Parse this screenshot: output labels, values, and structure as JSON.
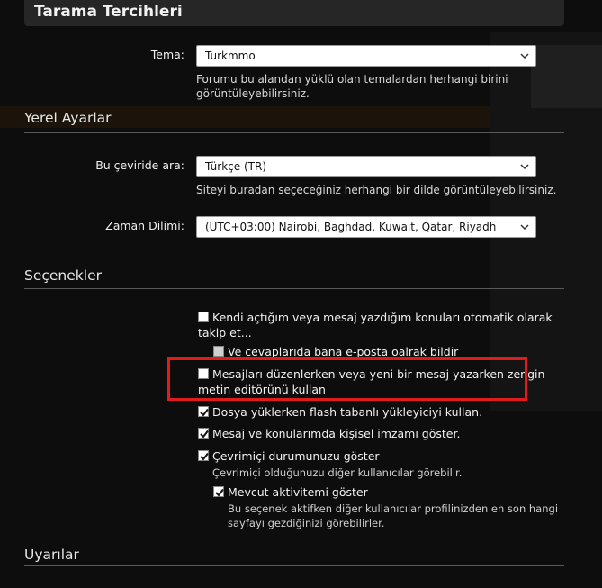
{
  "dialog": {
    "title": "Tarama Tercihleri"
  },
  "theme": {
    "label": "Tema:",
    "value": "Turkmmo",
    "hint_line1": "Forumu bu alandan yüklü olan temalardan herhangi birini",
    "hint_line2": "görüntüleyebilirsiniz."
  },
  "local": {
    "section_title": "Yerel Ayarlar",
    "language_label": "Bu çeviride ara:",
    "language_value": "Türkçe (TR)",
    "language_hint": "Siteyi buradan seçeceğiniz herhangi bir dilde görüntüleyebilirsiniz.",
    "timezone_label": "Zaman Dilimi:",
    "timezone_value": "(UTC+03:00) Nairobi, Baghdad, Kuwait, Qatar, Riyadh"
  },
  "options": {
    "section_title": "Seçenekler",
    "watch_line1": "Kendi açtığım veya mesaj yazdığım konuları otomatik olarak",
    "watch_line2": "takip et...",
    "email_label": "Ve cevaplarıda bana e-posta oalrak bildir",
    "editor_line1": "Mesajları düzenlerken veya yeni bir mesaj yazarken zengin",
    "editor_line2": "metin editörünü kullan",
    "flash_label": "Dosya yüklerken flash tabanlı yükleyiciyi kullan.",
    "signature_label": "Mesaj ve konularımda kişisel imzamı göster.",
    "online_label": "Çevrimiçi durumunuzu göster",
    "online_hint": "Çevrimiçi olduğunuzu diğer kullanıcılar görebilir.",
    "activity_label": "Mevcut aktivitemi göster",
    "activity_hint1": "Bu seçenek aktifken diğer kullanıcılar profilinizden en son hangi",
    "activity_hint2": "sayfayı gezdiğinizi görebilirler."
  },
  "warnings": {
    "section_title": "Uyarılar"
  },
  "states": {
    "watch": false,
    "email": false,
    "editor": false,
    "flash": true,
    "signature": true,
    "online": true,
    "activity": true
  },
  "colors": {
    "highlight": "#e11b1b",
    "background": "#0d0d0d",
    "title_bar": "#262626"
  }
}
